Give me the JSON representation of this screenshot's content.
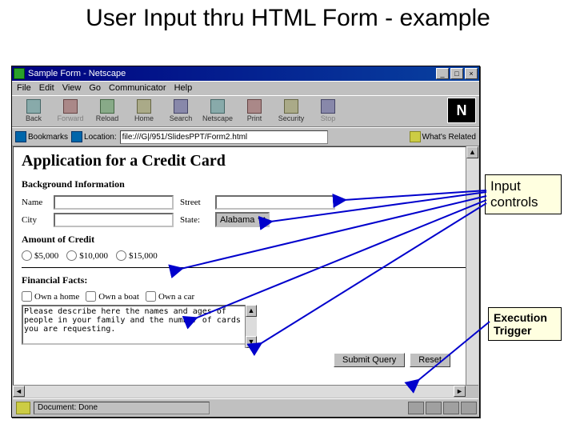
{
  "slide": {
    "title": "User Input thru HTML Form - example"
  },
  "titlebar": {
    "text": "Sample Form - Netscape"
  },
  "win": {
    "min": "_",
    "max": "□",
    "close": "×"
  },
  "menu": {
    "file": "File",
    "edit": "Edit",
    "view": "View",
    "go": "Go",
    "comm": "Communicator",
    "help": "Help"
  },
  "tb": {
    "back": "Back",
    "forward": "Forward",
    "reload": "Reload",
    "home": "Home",
    "search": "Search",
    "netscape": "Netscape",
    "print": "Print",
    "security": "Security",
    "stop": "Stop"
  },
  "loc": {
    "bookmarks": "Bookmarks",
    "loclabel": "Location:",
    "url": "file:///G|/951/SlidesPPT/Form2.html",
    "related": "What's Related"
  },
  "page": {
    "title": "Application for a Credit Card",
    "sect_bg": "Background Information",
    "lab_name": "Name",
    "lab_street": "Street",
    "lab_city": "City",
    "lab_state": "State:",
    "state_selected": "Alabama",
    "sect_credit": "Amount of Credit",
    "r1": "$5,000",
    "r2": "$10,000",
    "r3": "$15,000",
    "sect_fin": "Financial Facts:",
    "c1": "Own a home",
    "c2": "Own a boat",
    "c3": "Own a car",
    "textarea": "Please describe here the names and ages of people in your family and the number of cards you are requesting.",
    "submit": "Submit Query",
    "reset": "Reset"
  },
  "status": {
    "text": "Document: Done"
  },
  "callouts": {
    "input": "Input controls",
    "exec": "Execution Trigger"
  }
}
